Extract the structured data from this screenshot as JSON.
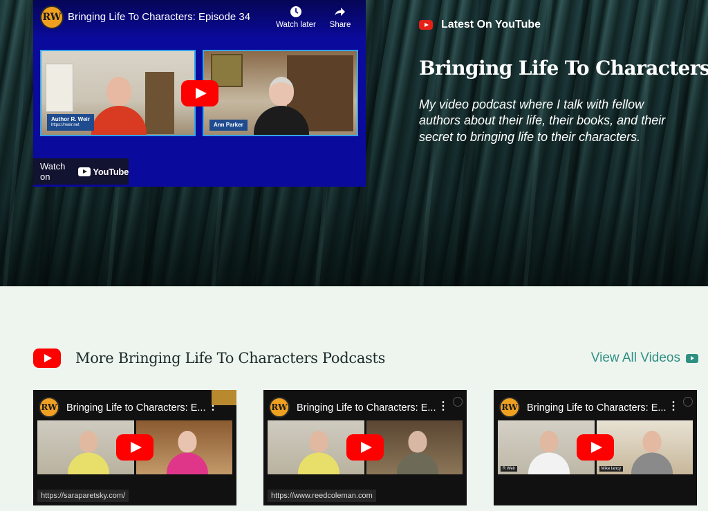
{
  "hero": {
    "latest_label": "Latest On YouTube",
    "title": "Bringing Life To Characters",
    "description": "My video podcast where I talk with fellow authors about their life, their books, and their secret to bringing life to their characters."
  },
  "main_video": {
    "logo_text": "RW",
    "title": "Bringing Life To Characters: Episode 34",
    "watch_later": "Watch later",
    "share": "Share",
    "left_label": "Author R. Weir",
    "left_sublabel": "https://rweir.net",
    "right_label": "Ann Parker",
    "watch_on": "Watch on",
    "youtube_word": "YouTube"
  },
  "section": {
    "title": "More Bringing Life To Characters Podcasts",
    "view_all": "View All Videos"
  },
  "cards": [
    {
      "logo_text": "RW",
      "title": "Bringing Life to Characters: E...",
      "url": "https://saraparetsky.com/"
    },
    {
      "logo_text": "RW",
      "title": "Bringing Life to Characters: E...",
      "url": "https://www.reedcoleman.com"
    },
    {
      "logo_text": "RW",
      "title": "Bringing Life to Characters: E...",
      "url": ""
    }
  ],
  "card3_labels": {
    "left": "R Weir",
    "right": "Mike Iancy"
  },
  "colors": {
    "accent": "#2f8f83",
    "youtube_red": "#ff0000",
    "video_bg": "#0a0a9c"
  }
}
